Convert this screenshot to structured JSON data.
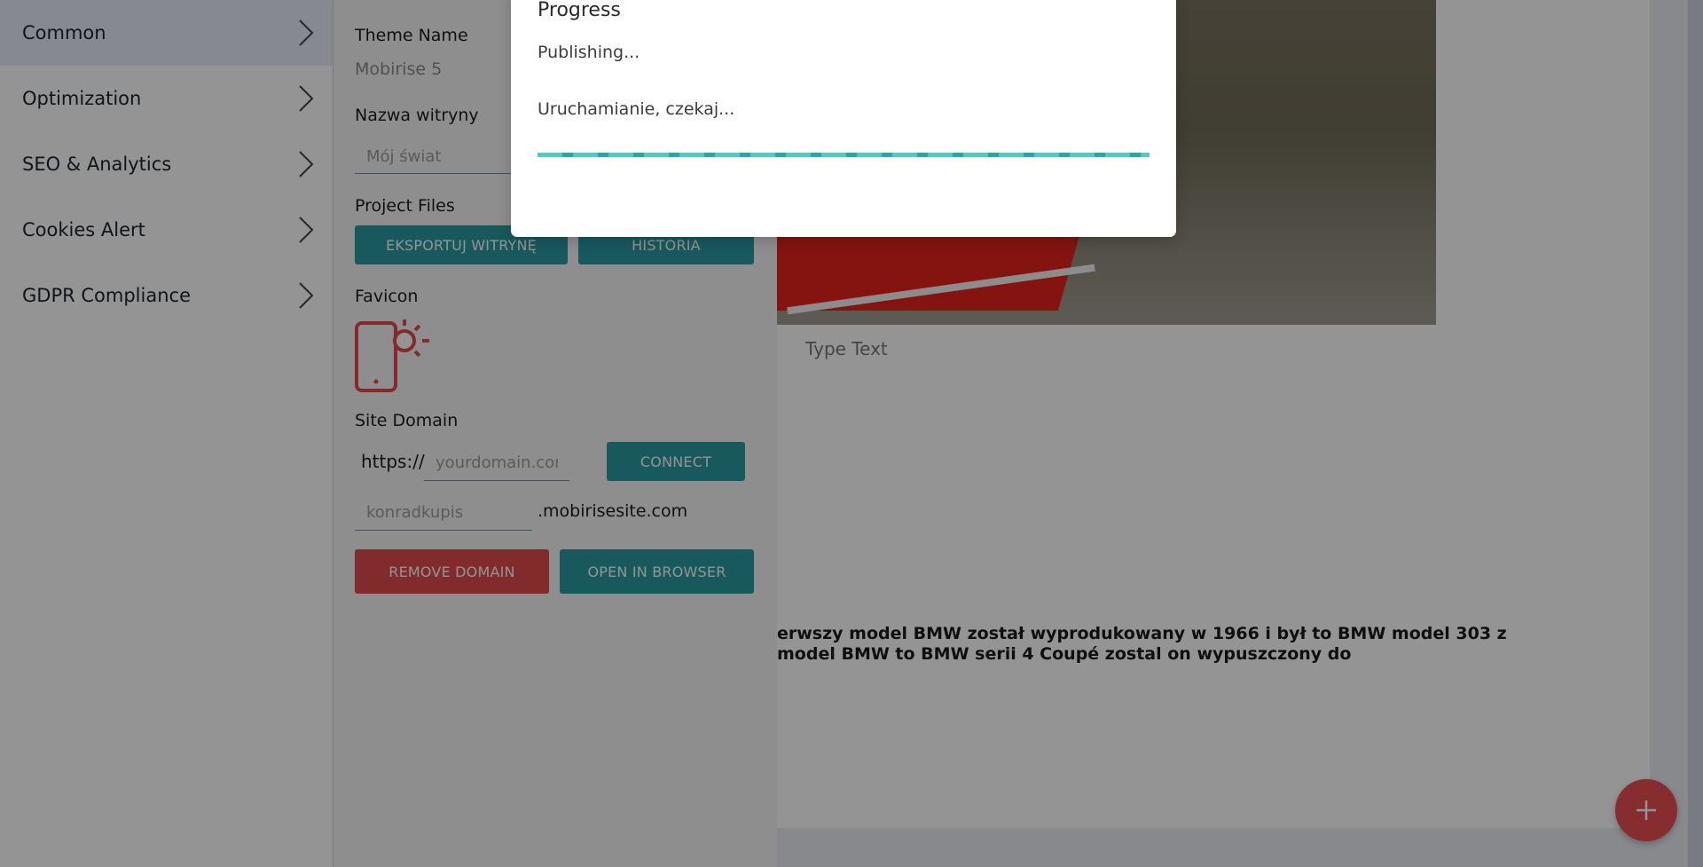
{
  "nav": {
    "items": [
      {
        "label": "Common",
        "active": true
      },
      {
        "label": "Optimization",
        "active": false
      },
      {
        "label": "SEO & Analytics",
        "active": false
      },
      {
        "label": "Cookies Alert",
        "active": false
      },
      {
        "label": "GDPR Compliance",
        "active": false
      }
    ]
  },
  "panel": {
    "theme_name_label": "Theme Name",
    "theme_name_value": "Mobirise 5",
    "site_name_label": "Nazwa witryny",
    "site_name_placeholder": "Mój świat",
    "project_files_label": "Project Files",
    "export_button": "EKSPORTUJ WITRYNĘ",
    "history_button": "HISTORIA",
    "favicon_label": "Favicon",
    "site_domain_label": "Site Domain",
    "https_prefix": "https://",
    "domain_placeholder": "yourdomain.com",
    "connect_button": "CONNECT",
    "subdomain_value": "konradkupis",
    "subdomain_suffix": ".mobirisesite.com",
    "remove_domain_button": "REMOVE DOMAIN",
    "open_browser_button": "OPEN IN BROWSER"
  },
  "preview": {
    "caption": "Type Text",
    "text_line1": "erwszy model BMW został wyprodukowany w 1966 i był to BMW model 303 z",
    "text_line2": " model BMW to BMW serii 4 Coupé zostal on wypuszczony do"
  },
  "modal": {
    "title": "Progress",
    "status": "Publishing...",
    "message": "Uruchamianie, czekaj...",
    "progress": 1.0
  },
  "colors": {
    "accent": "#2a9aa3",
    "danger": "#df4a4c",
    "fab": "#e94e52",
    "active_nav": "#e7edf6"
  },
  "icons": {
    "nav_chevron": "chevron-right-icon",
    "favicon": "phone-sun-icon",
    "fab": "plus-icon"
  }
}
